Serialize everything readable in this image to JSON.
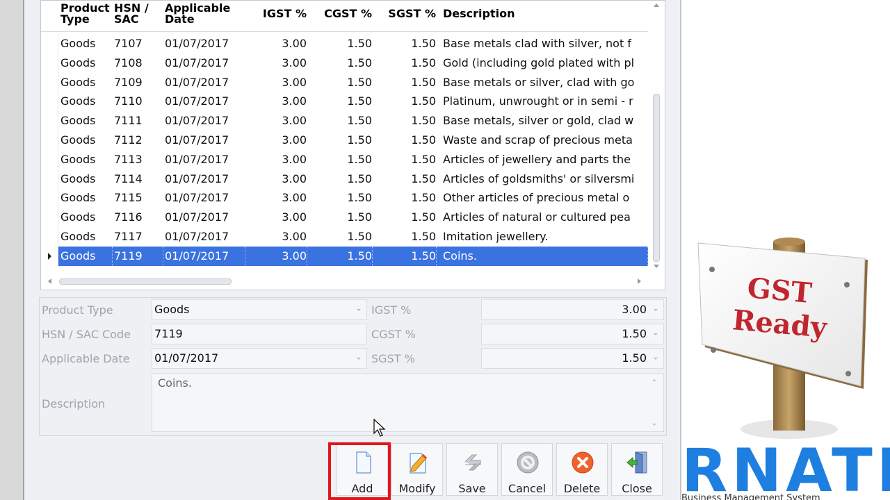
{
  "grid": {
    "columns": [
      {
        "key": "type",
        "label": "Product\nType"
      },
      {
        "key": "hsn",
        "label": "HSN /\nSAC"
      },
      {
        "key": "date",
        "label": "Applicable\nDate"
      },
      {
        "key": "igst",
        "label": "IGST %"
      },
      {
        "key": "cgst",
        "label": "CGST %"
      },
      {
        "key": "sgst",
        "label": "SGST %"
      },
      {
        "key": "desc",
        "label": "Description"
      }
    ],
    "rows": [
      {
        "type": "Goods",
        "hsn": "7107",
        "date": "01/07/2017",
        "igst": "3.00",
        "cgst": "1.50",
        "sgst": "1.50",
        "desc": "Base metals clad with silver, not f"
      },
      {
        "type": "Goods",
        "hsn": "7108",
        "date": "01/07/2017",
        "igst": "3.00",
        "cgst": "1.50",
        "sgst": "1.50",
        "desc": "Gold (including gold plated with pl"
      },
      {
        "type": "Goods",
        "hsn": "7109",
        "date": "01/07/2017",
        "igst": "3.00",
        "cgst": "1.50",
        "sgst": "1.50",
        "desc": "Base metals or silver, clad with go"
      },
      {
        "type": "Goods",
        "hsn": "7110",
        "date": "01/07/2017",
        "igst": "3.00",
        "cgst": "1.50",
        "sgst": "1.50",
        "desc": "Platinum, unwrought or in semi - r"
      },
      {
        "type": "Goods",
        "hsn": "7111",
        "date": "01/07/2017",
        "igst": "3.00",
        "cgst": "1.50",
        "sgst": "1.50",
        "desc": "Base metals, silver or gold, clad w"
      },
      {
        "type": "Goods",
        "hsn": "7112",
        "date": "01/07/2017",
        "igst": "3.00",
        "cgst": "1.50",
        "sgst": "1.50",
        "desc": "Waste and scrap of precious meta"
      },
      {
        "type": "Goods",
        "hsn": "7113",
        "date": "01/07/2017",
        "igst": "3.00",
        "cgst": "1.50",
        "sgst": "1.50",
        "desc": "Articles of jewellery and parts the"
      },
      {
        "type": "Goods",
        "hsn": "7114",
        "date": "01/07/2017",
        "igst": "3.00",
        "cgst": "1.50",
        "sgst": "1.50",
        "desc": "Articles of goldsmiths' or silversmi"
      },
      {
        "type": "Goods",
        "hsn": "7115",
        "date": "01/07/2017",
        "igst": "3.00",
        "cgst": "1.50",
        "sgst": "1.50",
        "desc": "Other articles of precious metal o"
      },
      {
        "type": "Goods",
        "hsn": "7116",
        "date": "01/07/2017",
        "igst": "3.00",
        "cgst": "1.50",
        "sgst": "1.50",
        "desc": "Articles of natural or cultured pea"
      },
      {
        "type": "Goods",
        "hsn": "7117",
        "date": "01/07/2017",
        "igst": "3.00",
        "cgst": "1.50",
        "sgst": "1.50",
        "desc": "Imitation jewellery."
      },
      {
        "type": "Goods",
        "hsn": "7119",
        "date": "01/07/2017",
        "igst": "3.00",
        "cgst": "1.50",
        "sgst": "1.50",
        "desc": "Coins.",
        "selected": true
      }
    ]
  },
  "form": {
    "product_type_label": "Product Type",
    "product_type_value": "Goods",
    "hsn_label": "HSN / SAC Code",
    "hsn_value": "7119",
    "date_label": "Applicable Date",
    "date_value": "01/07/2017",
    "igst_label": "IGST %",
    "igst_value": "3.00",
    "cgst_label": "CGST %",
    "cgst_value": "1.50",
    "sgst_label": "SGST %",
    "sgst_value": "1.50",
    "description_label": "Description",
    "description_value": "Coins."
  },
  "toolbar": {
    "buttons": [
      {
        "id": "add",
        "label": "Add",
        "icon": "new-document-icon"
      },
      {
        "id": "modify",
        "label": "Modify",
        "icon": "pencil-document-icon"
      },
      {
        "id": "save",
        "label": "Save",
        "icon": "save-arrows-icon"
      },
      {
        "id": "cancel",
        "label": "Cancel",
        "icon": "cancel-circle-icon"
      },
      {
        "id": "delete",
        "label": "Delete",
        "icon": "delete-x-icon"
      },
      {
        "id": "close",
        "label": "Close",
        "icon": "exit-door-icon"
      }
    ],
    "highlight_color": "#e2141e"
  },
  "sign": {
    "line1": "GST",
    "line2": "Ready"
  },
  "brand": {
    "text": "RNATE",
    "subtitle": "Business Management System"
  },
  "colors": {
    "selection": "#3a72df",
    "sign_text": "#c0262e",
    "brand_blue": "#1e7fe0"
  }
}
